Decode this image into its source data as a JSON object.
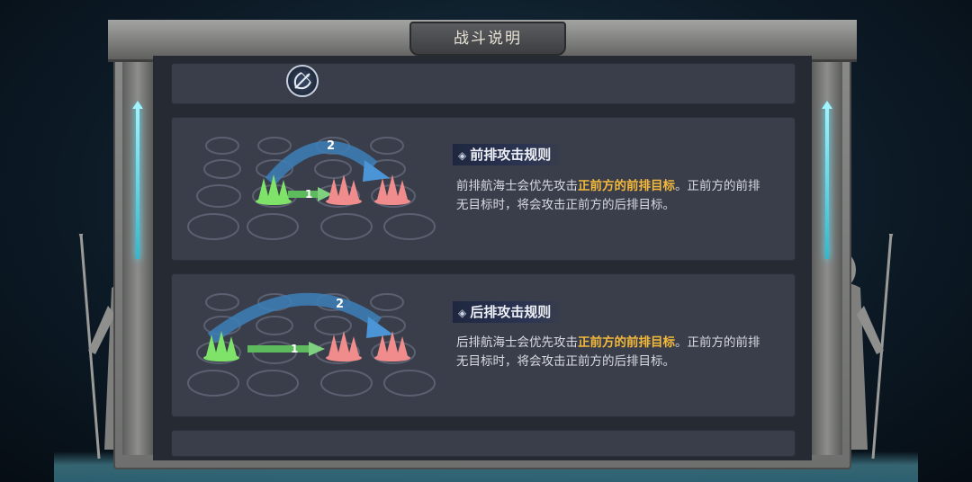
{
  "dialog": {
    "title": "战斗说明"
  },
  "header": {
    "icon": "bow-crossbow-icon"
  },
  "rules": [
    {
      "title": "前排攻击规则",
      "text_before": "前排航海士会优先攻击",
      "highlight": "正前方的前排目标",
      "text_after": "。正前方的前排无目标时，将会攻击正前方的后排目标。",
      "diagram": {
        "arrow_primary_label": "1",
        "arrow_secondary_label": "2",
        "ally_color": "#7fe36a",
        "enemy_color": "#f08c8c"
      }
    },
    {
      "title": "后排攻击规则",
      "text_before": "后排航海士会优先攻击",
      "highlight": "正前方的前排目标",
      "text_after": "。正前方的前排无目标时，将会攻击正前方的后排目标。",
      "diagram": {
        "arrow_primary_label": "1",
        "arrow_secondary_label": "2",
        "ally_color": "#7fe36a",
        "enemy_color": "#f08c8c"
      }
    }
  ],
  "colors": {
    "highlight": "#f4b93a",
    "panel": "#3a3e4b",
    "glow": "#48d9f0"
  }
}
